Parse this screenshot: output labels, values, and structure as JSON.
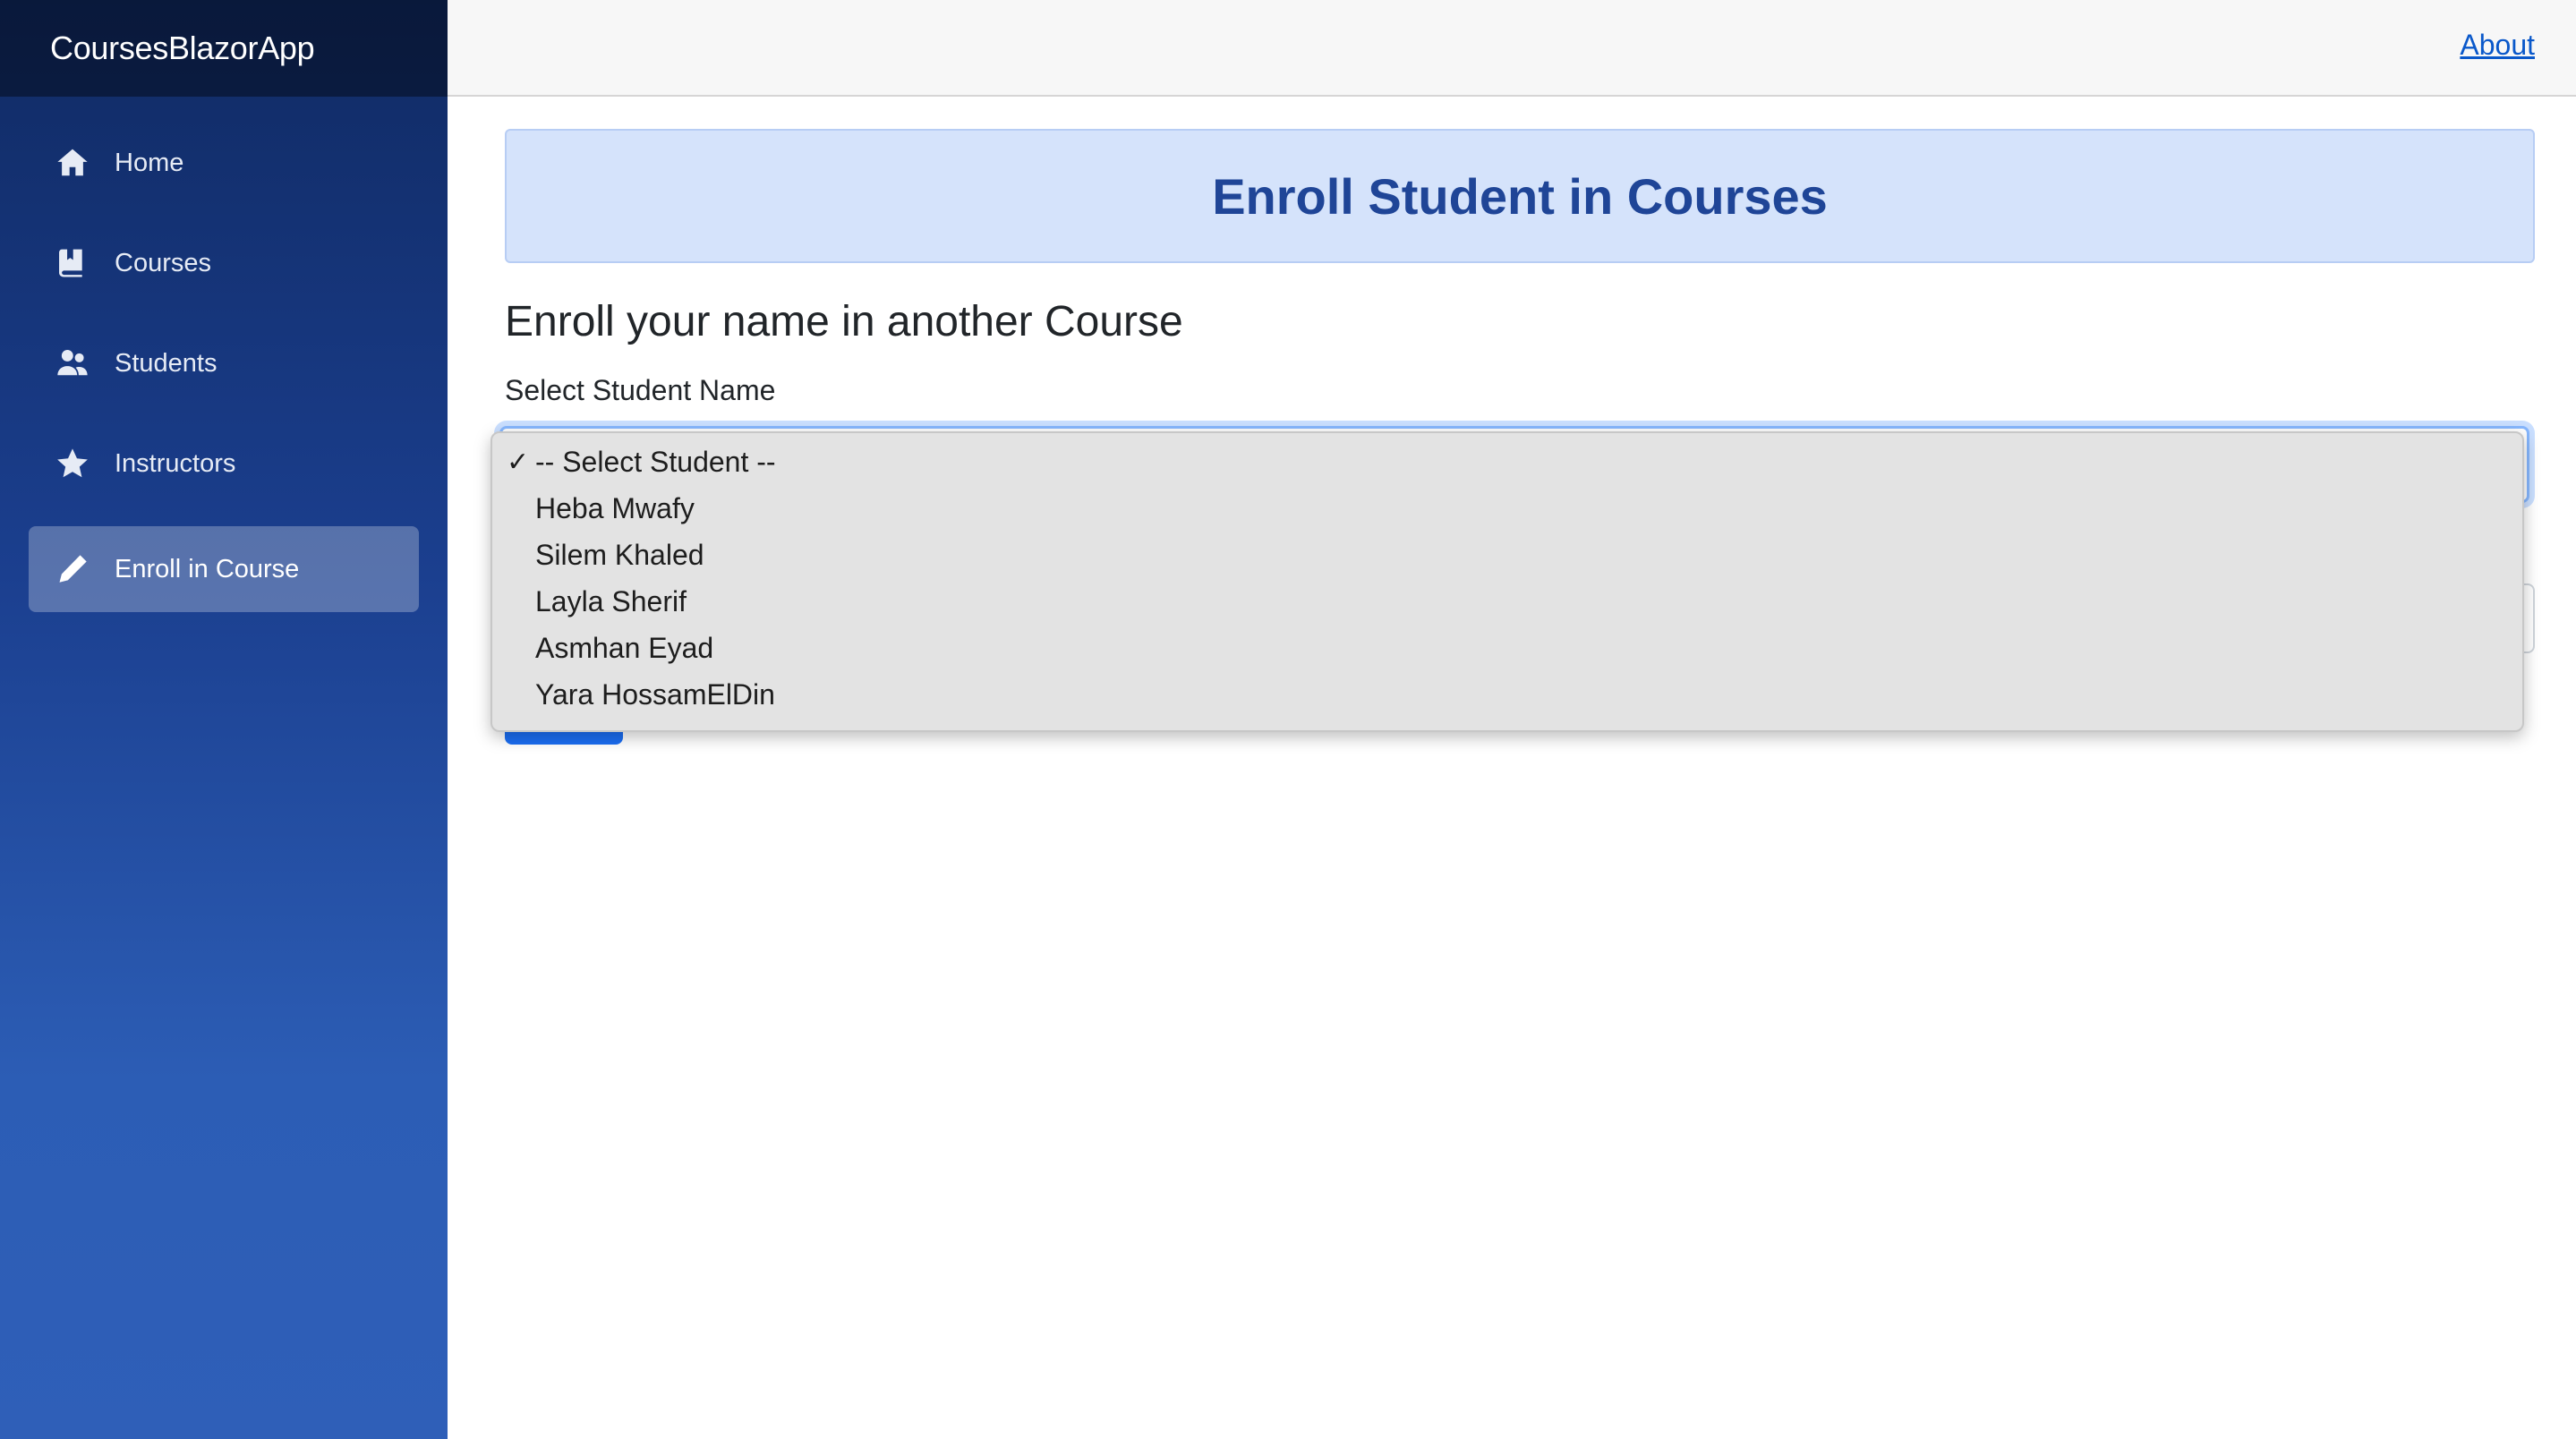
{
  "app": {
    "brand": "CoursesBlazorApp"
  },
  "sidebar": {
    "items": [
      {
        "label": "Home",
        "icon": "home-icon",
        "active": false
      },
      {
        "label": "Courses",
        "icon": "book-icon",
        "active": false
      },
      {
        "label": "Students",
        "icon": "people-icon",
        "active": false
      },
      {
        "label": "Instructors",
        "icon": "star-icon",
        "active": false
      },
      {
        "label": "Enroll in Course",
        "icon": "pencil-icon",
        "active": true
      }
    ]
  },
  "header": {
    "about_link": "About"
  },
  "main": {
    "title": "Enroll Student in Courses",
    "subtitle": "Enroll your name in another Course",
    "student_label": "Select Student Name"
  },
  "dropdown": {
    "selected": "-- Select Student --",
    "check_mark": "✓",
    "options": [
      "-- Select Student --",
      "Heba Mwafy",
      "Silem Khaled",
      "Layla Sherif",
      "Asmhan Eyad",
      "Yara HossamElDin"
    ]
  },
  "colors": {
    "sidebar_top": "#102a63",
    "sidebar_bottom": "#2f5fb8",
    "title_banner_bg": "#d5e3fb",
    "title_text": "#1f4597",
    "link": "#0a58ca",
    "primary_button": "#1b6ef3"
  }
}
